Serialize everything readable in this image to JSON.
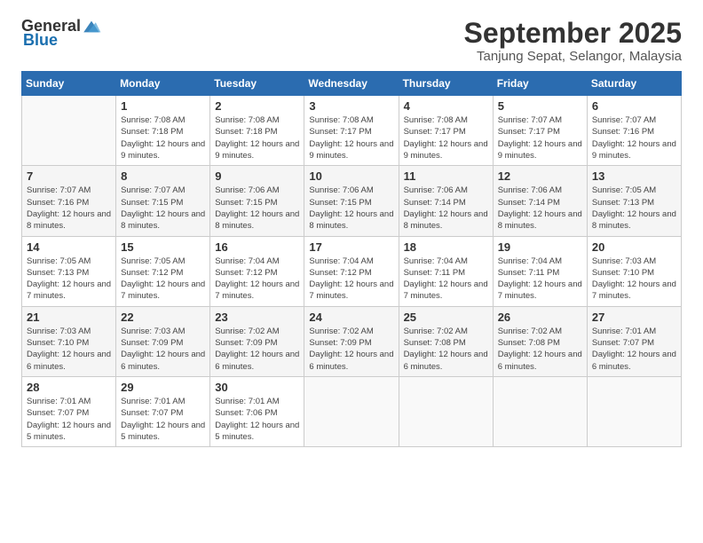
{
  "app": {
    "logo_general": "General",
    "logo_blue": "Blue"
  },
  "header": {
    "month": "September 2025",
    "location": "Tanjung Sepat, Selangor, Malaysia"
  },
  "weekdays": [
    "Sunday",
    "Monday",
    "Tuesday",
    "Wednesday",
    "Thursday",
    "Friday",
    "Saturday"
  ],
  "weeks": [
    [
      {
        "day": "",
        "sunrise": "",
        "sunset": "",
        "daylight": ""
      },
      {
        "day": "1",
        "sunrise": "Sunrise: 7:08 AM",
        "sunset": "Sunset: 7:18 PM",
        "daylight": "Daylight: 12 hours and 9 minutes."
      },
      {
        "day": "2",
        "sunrise": "Sunrise: 7:08 AM",
        "sunset": "Sunset: 7:18 PM",
        "daylight": "Daylight: 12 hours and 9 minutes."
      },
      {
        "day": "3",
        "sunrise": "Sunrise: 7:08 AM",
        "sunset": "Sunset: 7:17 PM",
        "daylight": "Daylight: 12 hours and 9 minutes."
      },
      {
        "day": "4",
        "sunrise": "Sunrise: 7:08 AM",
        "sunset": "Sunset: 7:17 PM",
        "daylight": "Daylight: 12 hours and 9 minutes."
      },
      {
        "day": "5",
        "sunrise": "Sunrise: 7:07 AM",
        "sunset": "Sunset: 7:17 PM",
        "daylight": "Daylight: 12 hours and 9 minutes."
      },
      {
        "day": "6",
        "sunrise": "Sunrise: 7:07 AM",
        "sunset": "Sunset: 7:16 PM",
        "daylight": "Daylight: 12 hours and 9 minutes."
      }
    ],
    [
      {
        "day": "7",
        "sunrise": "Sunrise: 7:07 AM",
        "sunset": "Sunset: 7:16 PM",
        "daylight": "Daylight: 12 hours and 8 minutes."
      },
      {
        "day": "8",
        "sunrise": "Sunrise: 7:07 AM",
        "sunset": "Sunset: 7:15 PM",
        "daylight": "Daylight: 12 hours and 8 minutes."
      },
      {
        "day": "9",
        "sunrise": "Sunrise: 7:06 AM",
        "sunset": "Sunset: 7:15 PM",
        "daylight": "Daylight: 12 hours and 8 minutes."
      },
      {
        "day": "10",
        "sunrise": "Sunrise: 7:06 AM",
        "sunset": "Sunset: 7:15 PM",
        "daylight": "Daylight: 12 hours and 8 minutes."
      },
      {
        "day": "11",
        "sunrise": "Sunrise: 7:06 AM",
        "sunset": "Sunset: 7:14 PM",
        "daylight": "Daylight: 12 hours and 8 minutes."
      },
      {
        "day": "12",
        "sunrise": "Sunrise: 7:06 AM",
        "sunset": "Sunset: 7:14 PM",
        "daylight": "Daylight: 12 hours and 8 minutes."
      },
      {
        "day": "13",
        "sunrise": "Sunrise: 7:05 AM",
        "sunset": "Sunset: 7:13 PM",
        "daylight": "Daylight: 12 hours and 8 minutes."
      }
    ],
    [
      {
        "day": "14",
        "sunrise": "Sunrise: 7:05 AM",
        "sunset": "Sunset: 7:13 PM",
        "daylight": "Daylight: 12 hours and 7 minutes."
      },
      {
        "day": "15",
        "sunrise": "Sunrise: 7:05 AM",
        "sunset": "Sunset: 7:12 PM",
        "daylight": "Daylight: 12 hours and 7 minutes."
      },
      {
        "day": "16",
        "sunrise": "Sunrise: 7:04 AM",
        "sunset": "Sunset: 7:12 PM",
        "daylight": "Daylight: 12 hours and 7 minutes."
      },
      {
        "day": "17",
        "sunrise": "Sunrise: 7:04 AM",
        "sunset": "Sunset: 7:12 PM",
        "daylight": "Daylight: 12 hours and 7 minutes."
      },
      {
        "day": "18",
        "sunrise": "Sunrise: 7:04 AM",
        "sunset": "Sunset: 7:11 PM",
        "daylight": "Daylight: 12 hours and 7 minutes."
      },
      {
        "day": "19",
        "sunrise": "Sunrise: 7:04 AM",
        "sunset": "Sunset: 7:11 PM",
        "daylight": "Daylight: 12 hours and 7 minutes."
      },
      {
        "day": "20",
        "sunrise": "Sunrise: 7:03 AM",
        "sunset": "Sunset: 7:10 PM",
        "daylight": "Daylight: 12 hours and 7 minutes."
      }
    ],
    [
      {
        "day": "21",
        "sunrise": "Sunrise: 7:03 AM",
        "sunset": "Sunset: 7:10 PM",
        "daylight": "Daylight: 12 hours and 6 minutes."
      },
      {
        "day": "22",
        "sunrise": "Sunrise: 7:03 AM",
        "sunset": "Sunset: 7:09 PM",
        "daylight": "Daylight: 12 hours and 6 minutes."
      },
      {
        "day": "23",
        "sunrise": "Sunrise: 7:02 AM",
        "sunset": "Sunset: 7:09 PM",
        "daylight": "Daylight: 12 hours and 6 minutes."
      },
      {
        "day": "24",
        "sunrise": "Sunrise: 7:02 AM",
        "sunset": "Sunset: 7:09 PM",
        "daylight": "Daylight: 12 hours and 6 minutes."
      },
      {
        "day": "25",
        "sunrise": "Sunrise: 7:02 AM",
        "sunset": "Sunset: 7:08 PM",
        "daylight": "Daylight: 12 hours and 6 minutes."
      },
      {
        "day": "26",
        "sunrise": "Sunrise: 7:02 AM",
        "sunset": "Sunset: 7:08 PM",
        "daylight": "Daylight: 12 hours and 6 minutes."
      },
      {
        "day": "27",
        "sunrise": "Sunrise: 7:01 AM",
        "sunset": "Sunset: 7:07 PM",
        "daylight": "Daylight: 12 hours and 6 minutes."
      }
    ],
    [
      {
        "day": "28",
        "sunrise": "Sunrise: 7:01 AM",
        "sunset": "Sunset: 7:07 PM",
        "daylight": "Daylight: 12 hours and 5 minutes."
      },
      {
        "day": "29",
        "sunrise": "Sunrise: 7:01 AM",
        "sunset": "Sunset: 7:07 PM",
        "daylight": "Daylight: 12 hours and 5 minutes."
      },
      {
        "day": "30",
        "sunrise": "Sunrise: 7:01 AM",
        "sunset": "Sunset: 7:06 PM",
        "daylight": "Daylight: 12 hours and 5 minutes."
      },
      {
        "day": "",
        "sunrise": "",
        "sunset": "",
        "daylight": ""
      },
      {
        "day": "",
        "sunrise": "",
        "sunset": "",
        "daylight": ""
      },
      {
        "day": "",
        "sunrise": "",
        "sunset": "",
        "daylight": ""
      },
      {
        "day": "",
        "sunrise": "",
        "sunset": "",
        "daylight": ""
      }
    ]
  ]
}
